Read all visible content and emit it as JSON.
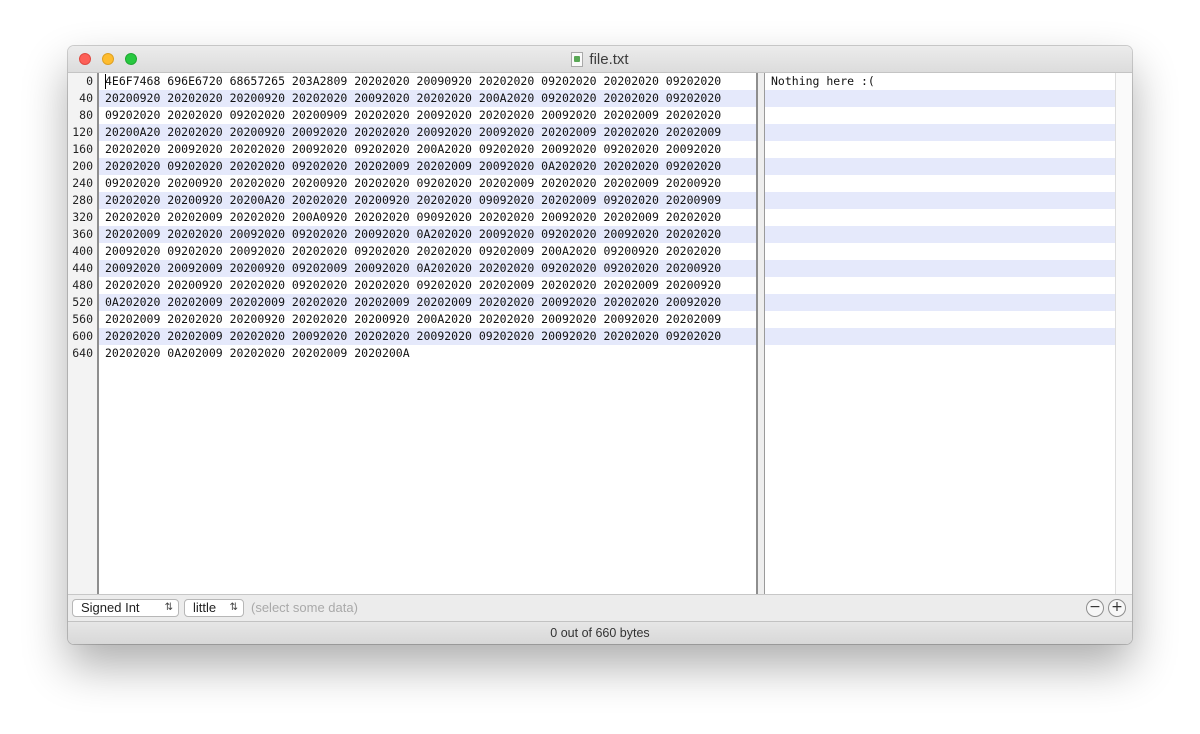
{
  "window": {
    "title": "file.txt",
    "icon": "text-document-icon"
  },
  "offsets": [
    "0",
    "40",
    "80",
    "120",
    "160",
    "200",
    "240",
    "280",
    "320",
    "360",
    "400",
    "440",
    "480",
    "520",
    "560",
    "600",
    "640"
  ],
  "hex_rows": [
    "4E6F7468 696E6720 68657265 203A2809 20202020 20090920 20202020 09202020 20202020 09202020",
    "20200920 20202020 20200920 20202020 20092020 20202020 200A2020 09202020 20202020 09202020",
    "09202020 20202020 09202020 20200909 20202020 20092020 20202020 20092020 20202009 20202020",
    "20200A20 20202020 20200920 20092020 20202020 20092020 20092020 20202009 20202020 20202009",
    "20202020 20092020 20202020 20092020 09202020 200A2020 09202020 20092020 09202020 20092020",
    "20202020 09202020 20202020 09202020 20202009 20202009 20092020 0A202020 20202020 09202020",
    "09202020 20200920 20202020 20200920 20202020 09202020 20202009 20202020 20202009 20200920",
    "20202020 20200920 20200A20 20202020 20200920 20202020 09092020 20202009 09202020 20200909",
    "20202020 20202009 20202020 200A0920 20202020 09092020 20202020 20092020 20202009 20202020",
    "20202009 20202020 20092020 09202020 20092020 0A202020 20092020 09202020 20092020 20202020",
    "20092020 09202020 20092020 20202020 09202020 20202020 09202009 200A2020 09200920 20202020",
    "20092020 20092009 20200920 09202009 20092020 0A202020 20202020 09202020 09202020 20200920",
    "20202020 20200920 20202020 09202020 20202020 09202020 20202009 20202020 20202009 20200920",
    "0A202020 20202009 20202009 20202020 20202009 20202009 20202020 20092020 20202020 20092020",
    "20202009 20202020 20200920 20202020 20200920 200A2020 20202020 20092020 20092020 20202009",
    "20202020 20202009 20202020 20092020 20202020 20092020 09202020 20092020 20202020 09202020",
    "20202020 0A202009 20202020 20202009 2020200A"
  ],
  "text_pane": {
    "first_line": "Nothing here :("
  },
  "bottom_bar": {
    "type_select": "Signed Int",
    "endian_select": "little",
    "value_placeholder": "(select some data)",
    "minus_label": "−",
    "plus_label": "+"
  },
  "status": {
    "text": "0 out of 660 bytes"
  },
  "colors": {
    "row_stripe": "#e5e9fb",
    "close": "#fd5f57",
    "minimize": "#febc2e",
    "maximize": "#28c840"
  }
}
